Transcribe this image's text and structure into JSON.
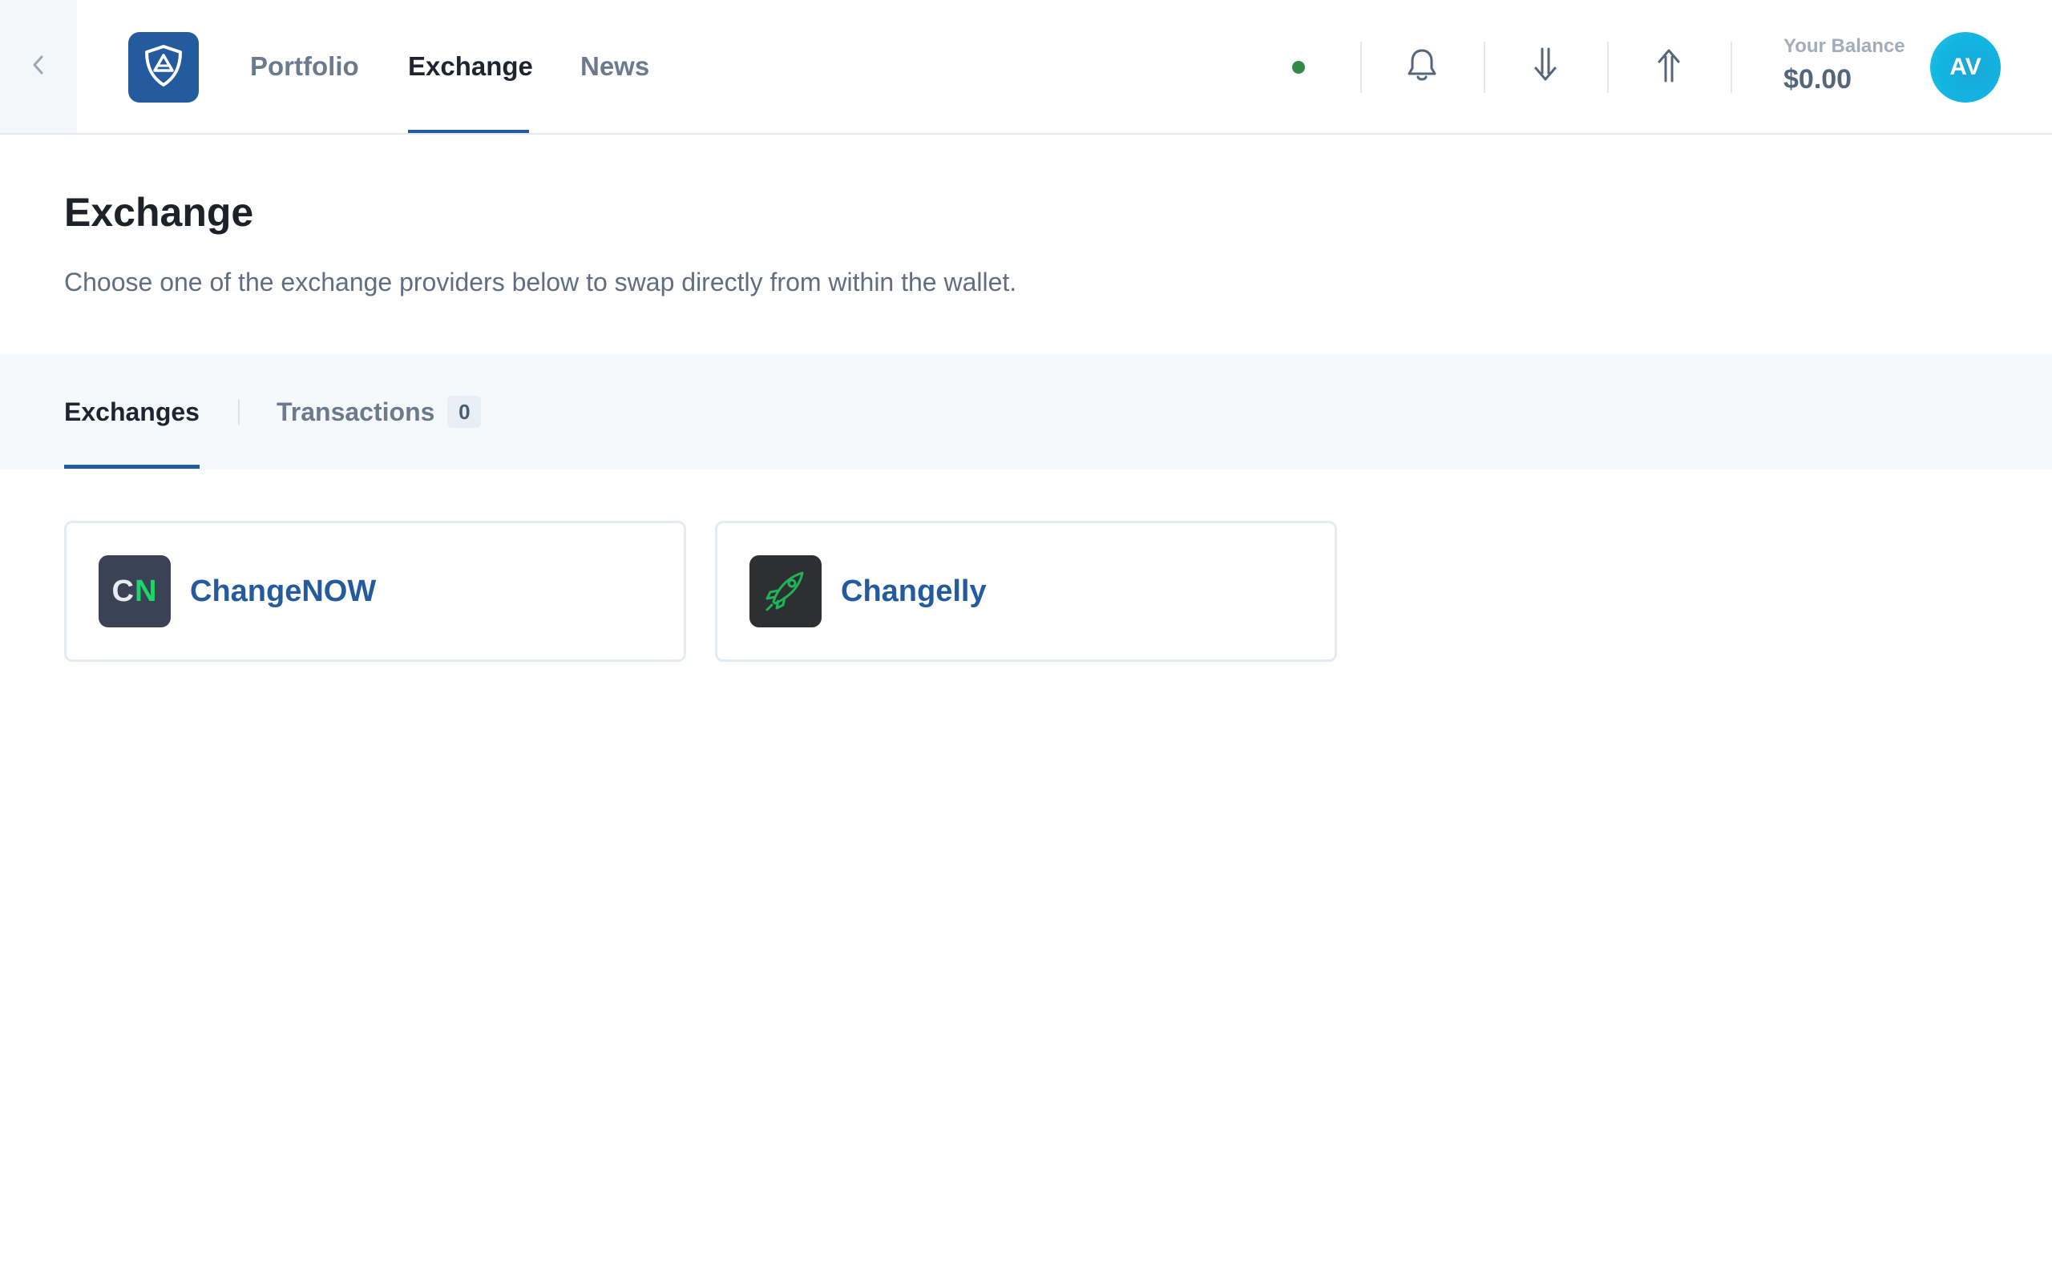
{
  "nav": {
    "items": [
      {
        "label": "Portfolio"
      },
      {
        "label": "Exchange"
      },
      {
        "label": "News"
      }
    ]
  },
  "header": {
    "balance_label": "Your Balance",
    "balance_value": "$0.00",
    "avatar_initials": "AV",
    "status_color": "#2f8a4a"
  },
  "page": {
    "title": "Exchange",
    "description": "Choose one of the exchange providers below to swap directly from within the wallet."
  },
  "tabs": [
    {
      "label": "Exchanges"
    },
    {
      "label": "Transactions",
      "count": "0"
    }
  ],
  "providers": [
    {
      "name": "ChangeNOW",
      "logo_text_c": "C",
      "logo_text_n": "N"
    },
    {
      "name": "Changelly",
      "icon": "rocket-icon"
    }
  ],
  "colors": {
    "accent": "#235b9e",
    "avatar": "#12b4e0",
    "changenow_green": "#21d46a",
    "changelly_green": "#1fb35a"
  }
}
